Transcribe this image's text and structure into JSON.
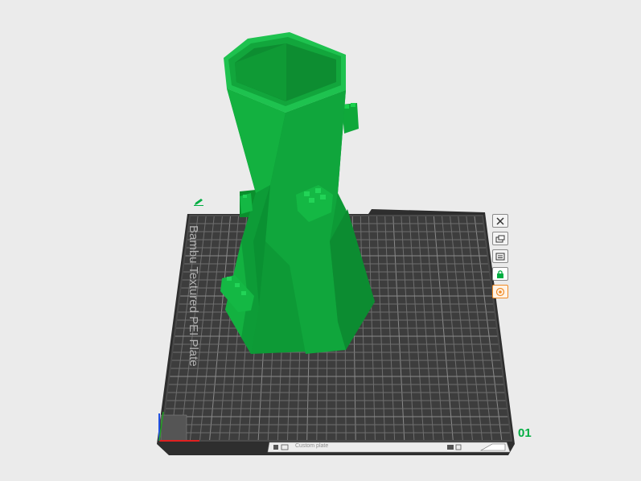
{
  "plate": {
    "name": "Bambu Textured PEI Plate",
    "number": "01",
    "bottom_label": "Custom plate"
  },
  "tools": [
    {
      "name": "close-plate-button",
      "icon": "close-icon"
    },
    {
      "name": "arrange-plate-button",
      "icon": "arrange-icon"
    },
    {
      "name": "plate-settings-button",
      "icon": "settings-icon"
    },
    {
      "name": "lock-plate-button",
      "icon": "lock-icon"
    },
    {
      "name": "auto-orient-button",
      "icon": "orient-icon"
    }
  ],
  "colors": {
    "model": "#00ae42",
    "plate": "#3b3b3b",
    "grid": "#6e6e6e",
    "accent": "#00ae42",
    "orient": "#f08c28",
    "background": "#ebebeb"
  }
}
